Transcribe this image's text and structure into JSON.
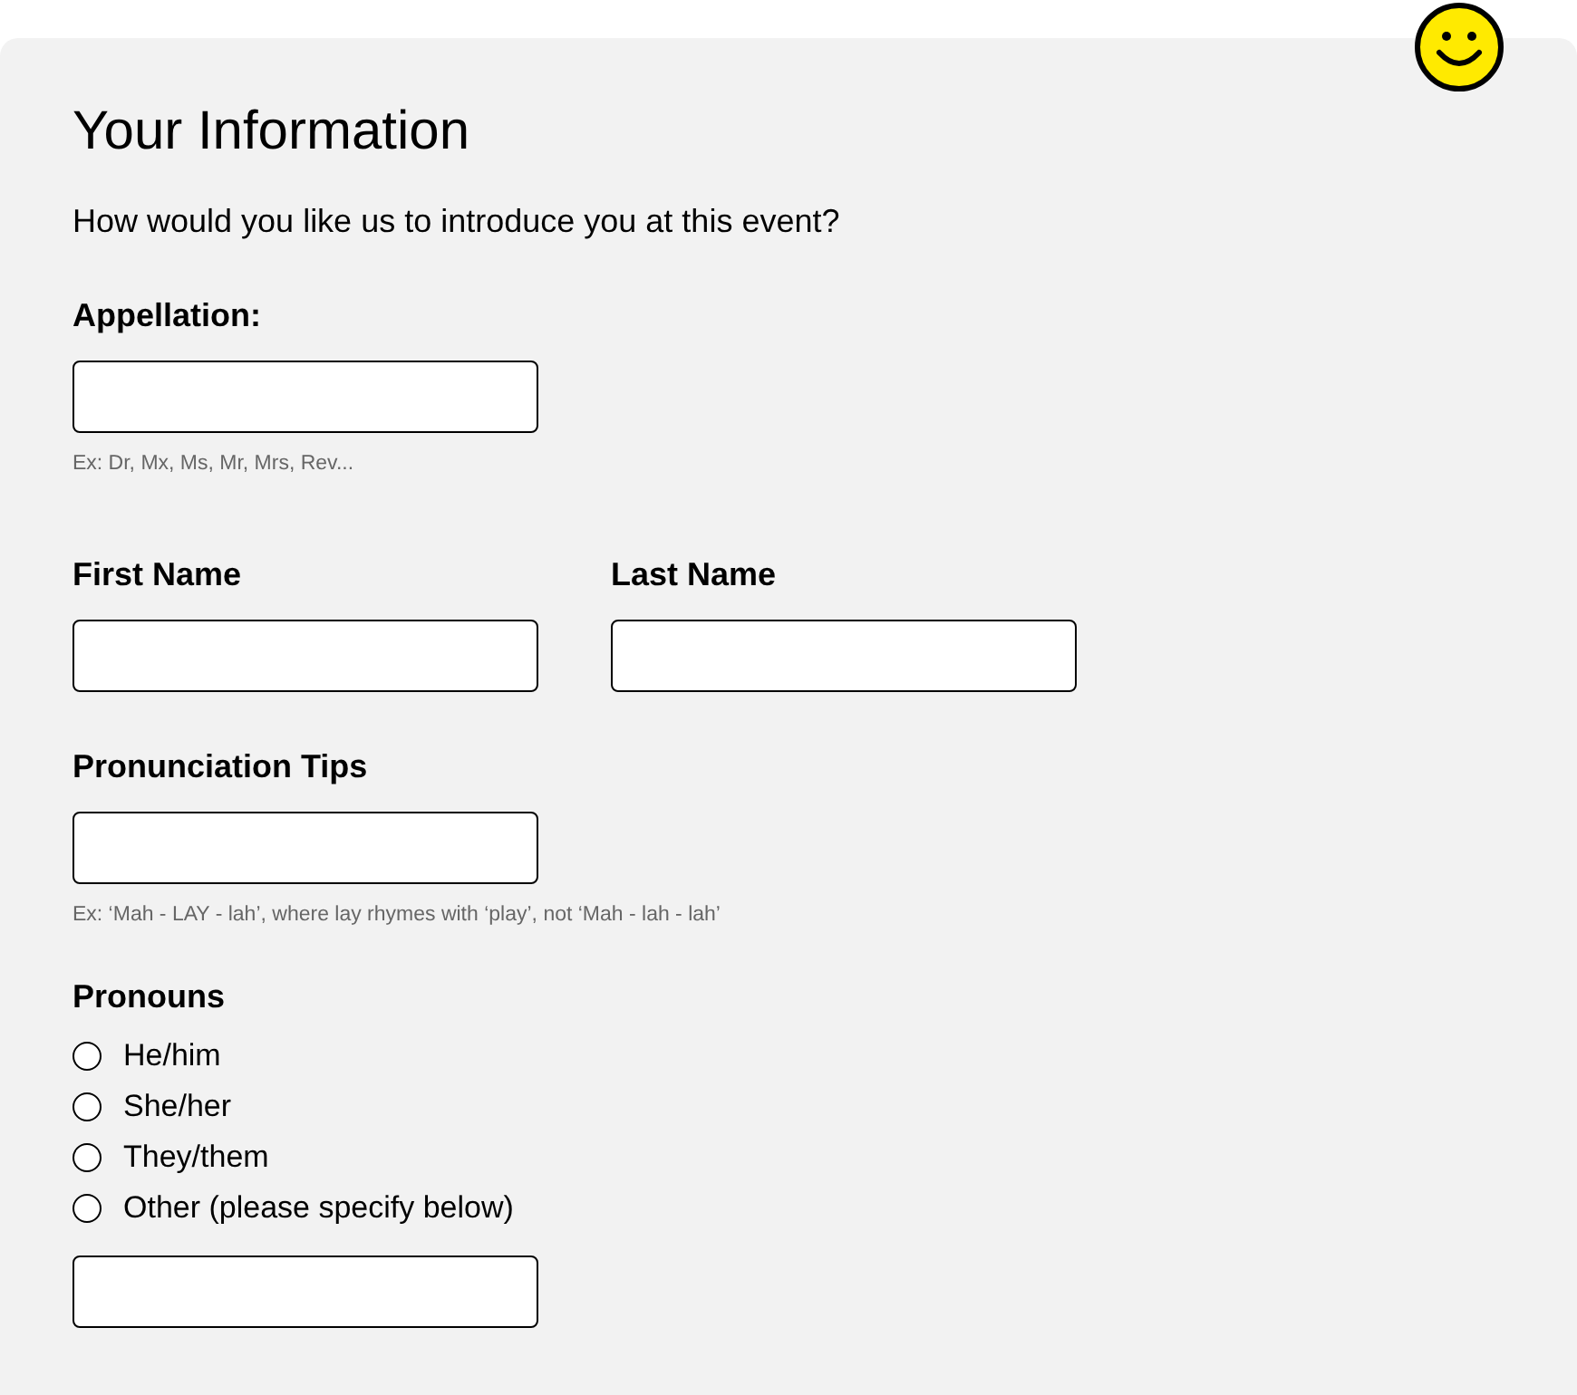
{
  "title": "Your Information",
  "intro": "How would you like us to introduce you at this event?",
  "appellation": {
    "label": "Appellation:",
    "hint": "Ex: Dr, Mx, Ms, Mr, Mrs, Rev..."
  },
  "name_fields": [
    {
      "label": "First Name"
    },
    {
      "label": "Last Name"
    }
  ],
  "pronunciation": {
    "label": "Pronunciation Tips",
    "hint": "Ex: ‘Mah - LAY -  lah’, where lay rhymes with ‘play’, not ‘Mah - lah - lah’"
  },
  "pronouns": {
    "label": "Pronouns",
    "options": [
      {
        "label": "He/him",
        "selected": false
      },
      {
        "label": "She/her",
        "selected": false
      },
      {
        "label": "They/them",
        "selected": false
      },
      {
        "label": "Other (please specify below)",
        "selected": false
      }
    ]
  }
}
